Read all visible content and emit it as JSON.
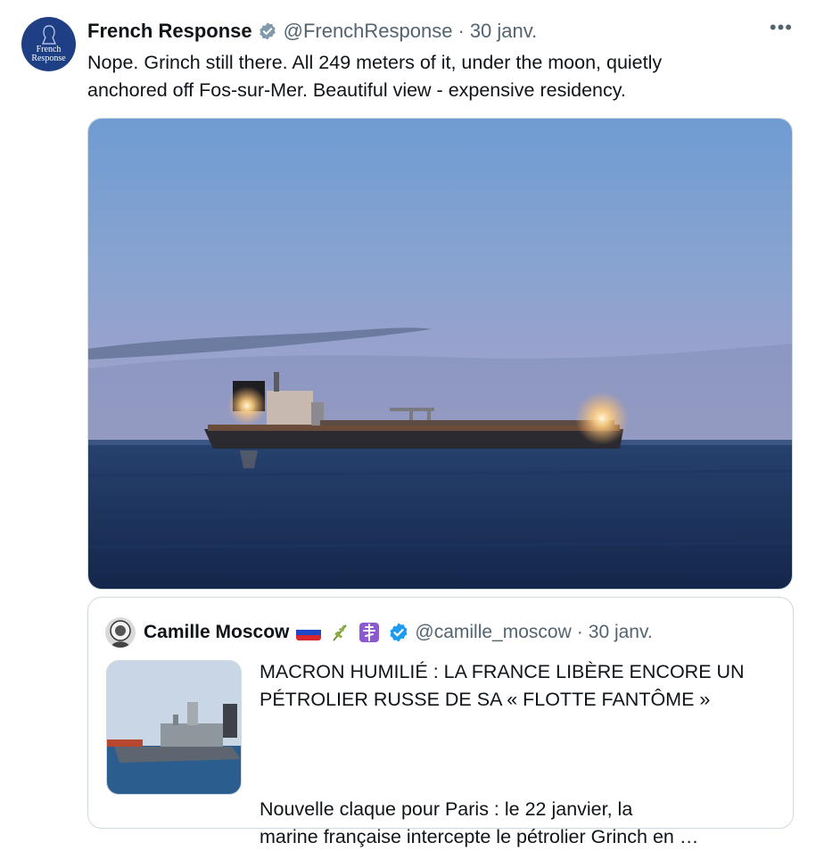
{
  "tweet": {
    "author_name": "French Response",
    "author_handle": "@FrenchResponse",
    "separator": "·",
    "date": "30 janv.",
    "text": "Nope. Grinch still there. All 249 meters of it, under the moon, quietly\nanchored off Fos-sur-Mer. Beautiful view - expensive residency.",
    "avatar_text_line1": "French",
    "avatar_text_line2": "Response",
    "more_label": "•••"
  },
  "quote": {
    "author_name": "Camille Moscow",
    "author_handle": "@camille_moscow",
    "separator": "·",
    "date": "30 janv.",
    "title": "MACRON HUMILIÉ : LA FRANCE LIBÈRE ENCORE UN\nPÉTROLIER RUSSE DE SA « FLOTTE FANTÔME »",
    "body": "Nouvelle claque pour Paris : le 22 janvier, la\nmarine française intercepte le pétrolier Grinch en …"
  },
  "icons": {
    "verified": "verified-badge-icon",
    "more": "more-options-icon",
    "flag_russia": "russia-flag-icon",
    "flag_france": "france-flag-icon",
    "olive": "olive-branch-icon",
    "cross": "orthodox-cross-icon"
  },
  "colors": {
    "verified_blue": "#1d9bf0",
    "secondary_text": "#536471",
    "border": "#cfd9de",
    "avatar_bg": "#1f3f85"
  }
}
